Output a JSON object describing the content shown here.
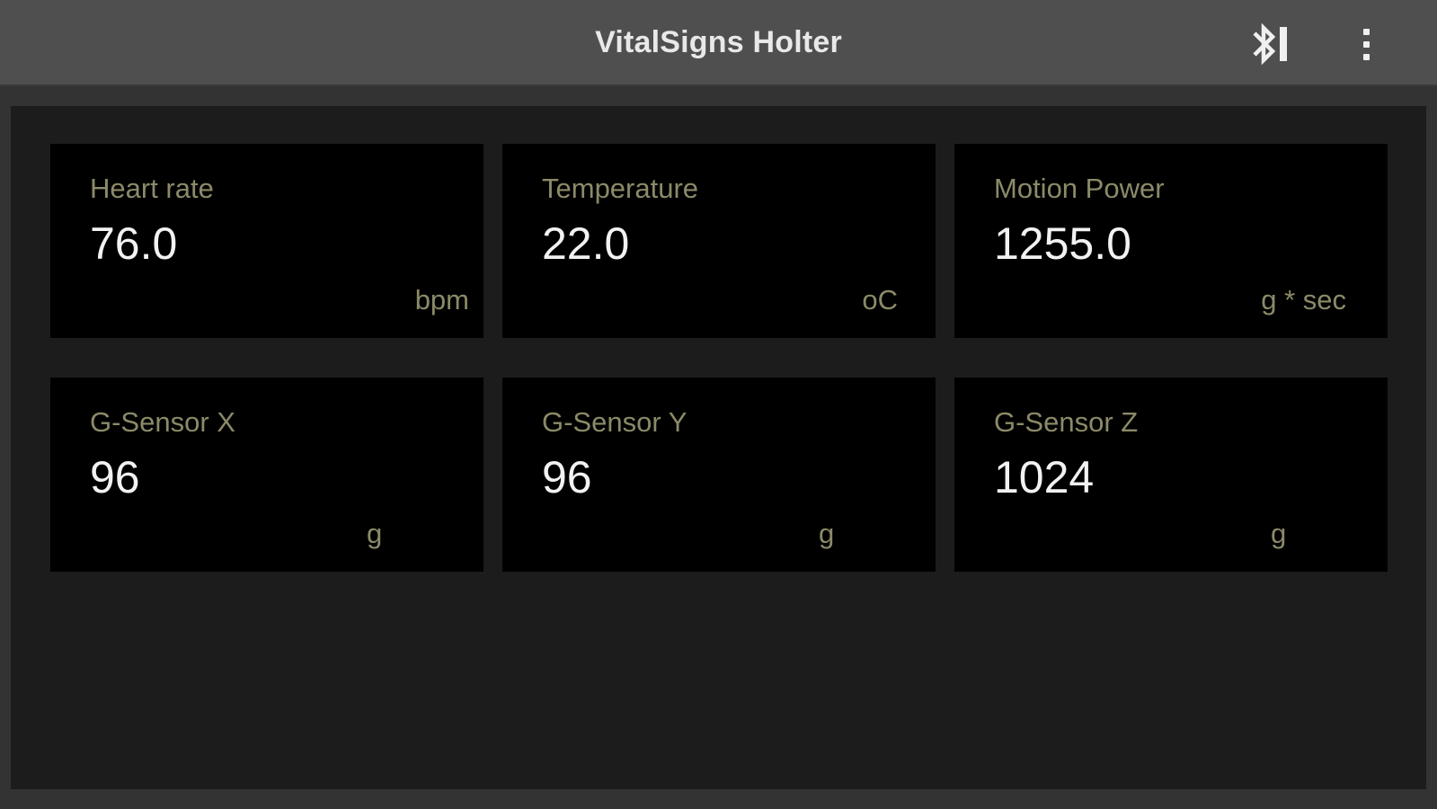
{
  "header": {
    "title": "VitalSigns Holter",
    "bluetooth_icon": "bluetooth-connected-icon",
    "menu_icon": "more-vert-icon"
  },
  "colors": {
    "header_bg": "#4f4f4f",
    "content_bg": "#1c1c1c",
    "card_bg": "#000000",
    "label": "#8c8a68",
    "value": "#f2f2f2"
  },
  "metrics": [
    {
      "label": "Heart rate",
      "value": "76.0",
      "unit": "bpm"
    },
    {
      "label": "Temperature",
      "value": "22.0",
      "unit": "oC"
    },
    {
      "label": "Motion Power",
      "value": "1255.0",
      "unit": "g * sec"
    },
    {
      "label": "G-Sensor X",
      "value": "96",
      "unit": "g"
    },
    {
      "label": "G-Sensor Y",
      "value": "96",
      "unit": "g"
    },
    {
      "label": "G-Sensor Z",
      "value": "1024",
      "unit": "g"
    }
  ]
}
